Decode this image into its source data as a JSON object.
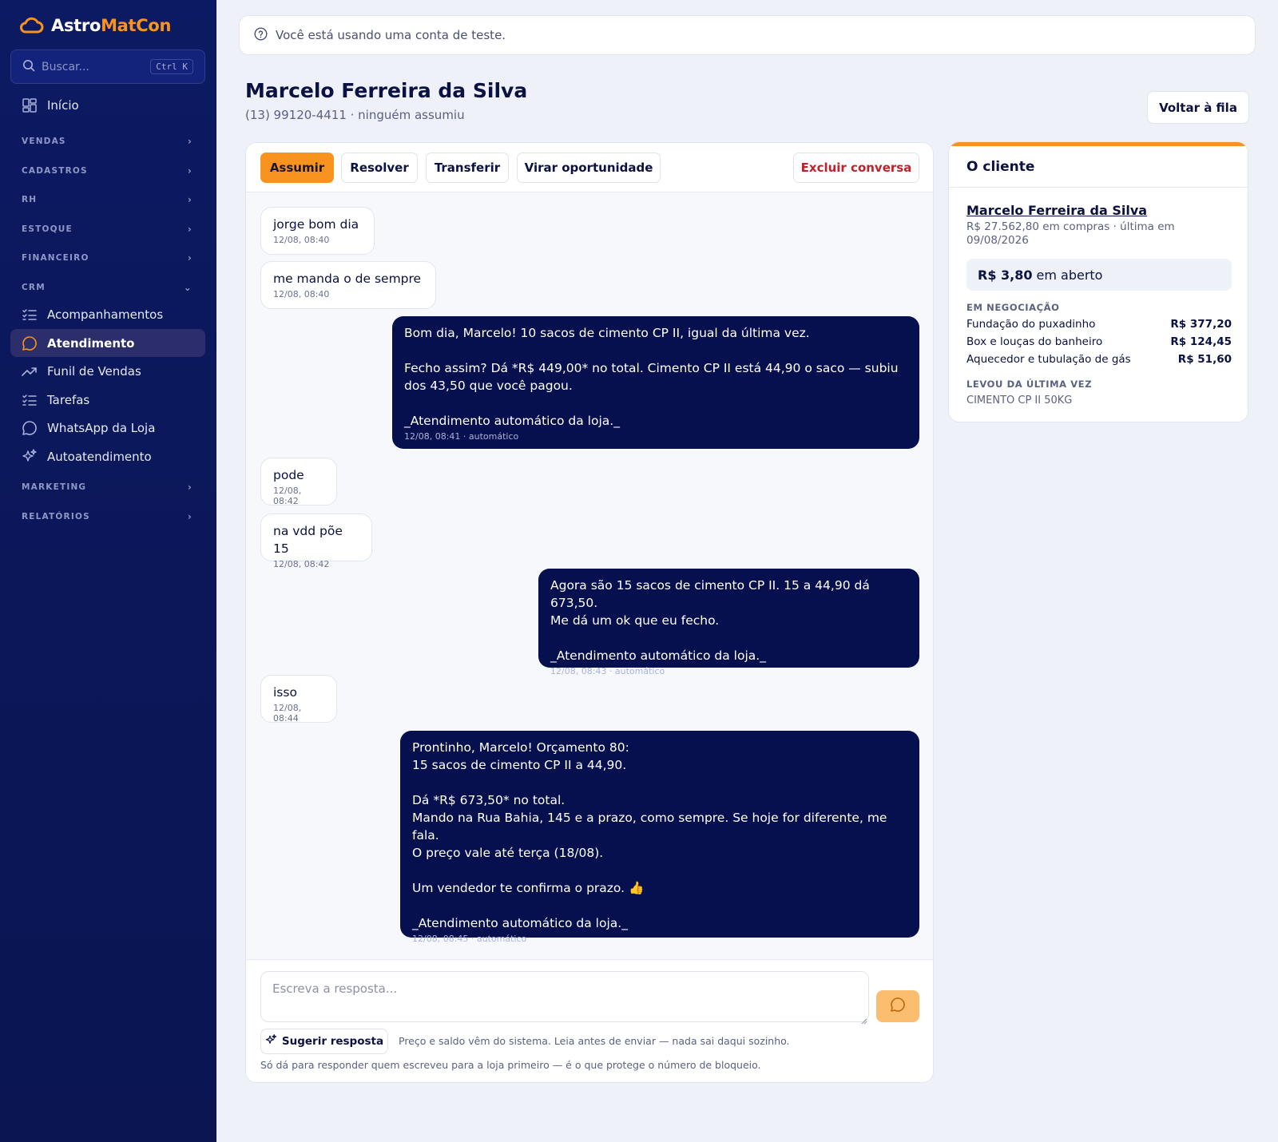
{
  "sidebar": {
    "brand": {
      "part1": "Astro",
      "part2": "MatCon"
    },
    "search": {
      "placeholder": "Buscar...",
      "shortcut": "Ctrl K"
    },
    "home": "Início",
    "sections": {
      "vendas": "VENDAS",
      "cadastros": "CADASTROS",
      "rh": "RH",
      "estoque": "ESTOQUE",
      "financeiro": "FINANCEIRO",
      "crm": "CRM",
      "marketing": "MARKETING",
      "relatorios": "RELATÓRIOS"
    },
    "crm_items": [
      {
        "label": "Acompanhamentos",
        "icon": "checklist-icon"
      },
      {
        "label": "Atendimento",
        "icon": "chat-bubble-icon",
        "active": true
      },
      {
        "label": "Funil de Vendas",
        "icon": "trending-up-icon"
      },
      {
        "label": "Tarefas",
        "icon": "checklist-icon"
      },
      {
        "label": "WhatsApp da Loja",
        "icon": "chat-bubble-icon"
      },
      {
        "label": "Autoatendimento",
        "icon": "sparkles-icon"
      }
    ]
  },
  "banner": {
    "text": "Você está usando uma conta de teste.",
    "icon": "help-circle-icon"
  },
  "header": {
    "title": "Marcelo Ferreira da Silva",
    "subtitle": "(13) 99120-4411 · ninguém assumiu",
    "back_label": "Voltar à fila"
  },
  "toolbar": {
    "assume": "Assumir",
    "resolve": "Resolver",
    "transfer": "Transferir",
    "opportunity": "Virar oportunidade",
    "delete": "Excluir conversa"
  },
  "messages": [
    {
      "dir": "in",
      "text": "jorge bom dia",
      "time": "12/08, 08:40"
    },
    {
      "dir": "in",
      "text": "me manda o de sempre",
      "time": "12/08, 08:40"
    },
    {
      "dir": "out",
      "text": "Bom dia, Marcelo! 10 sacos de cimento CP II, igual da última vez.\n\nFecho assim? Dá *R$ 449,00* no total. Cimento CP II está 44,90 o saco — subiu dos 43,50 que você pagou.\n\n_Atendimento automático da loja._",
      "time": "12/08, 08:41 · automático"
    },
    {
      "dir": "in",
      "text": "pode",
      "time": "12/08, 08:42"
    },
    {
      "dir": "in",
      "text": "na vdd põe 15",
      "time": "12/08, 08:42"
    },
    {
      "dir": "out",
      "text": "Agora são 15 sacos de cimento CP II. 15 a 44,90 dá 673,50.\nMe dá um ok que eu fecho.\n\n_Atendimento automático da loja._",
      "time": "12/08, 08:43 · automático"
    },
    {
      "dir": "in",
      "text": "isso",
      "time": "12/08, 08:44"
    },
    {
      "dir": "out",
      "text": "Prontinho, Marcelo! Orçamento 80:\n15 sacos de cimento CP II a 44,90.\n\nDá *R$ 673,50* no total.\nMando na Rua Bahia, 145 e a prazo, como sempre. Se hoje for diferente, me fala.\nO preço vale até terça (18/08).\n\nUm vendedor te confirma o prazo. 👍\n\n_Atendimento automático da loja._",
      "time": "12/08, 08:45 · automático"
    }
  ],
  "composer": {
    "placeholder": "Escreva a resposta...",
    "suggest_label": "Sugerir resposta",
    "hint": "Preço e saldo vêm do sistema. Leia antes de enviar — nada sai daqui sozinho.",
    "note": "Só dá para responder quem escreveu para a loja primeiro — é o que protege o número de bloqueio."
  },
  "client": {
    "title": "O cliente",
    "name": "Marcelo Ferreira da Silva",
    "meta": "R$ 27.562,80 em compras · última em 09/08/2026",
    "open_amount": "R$ 3,80",
    "open_suffix": "em aberto",
    "negotiation_label": "EM NEGOCIAÇÃO",
    "negotiations": [
      {
        "name": "Fundação do puxadinho",
        "value": "R$ 377,20"
      },
      {
        "name": "Box e louças do banheiro",
        "value": "R$ 124,45"
      },
      {
        "name": "Aquecedor e tubulação de gás",
        "value": "R$ 51,60"
      }
    ],
    "last_label": "LEVOU DA ÚLTIMA VEZ",
    "last_item": "CIMENTO CP II 50KG"
  },
  "colors": {
    "accent": "#f7931e",
    "sidebar": "#0c1a63",
    "outgoing_bubble": "#06104e",
    "danger": "#c0222b"
  }
}
